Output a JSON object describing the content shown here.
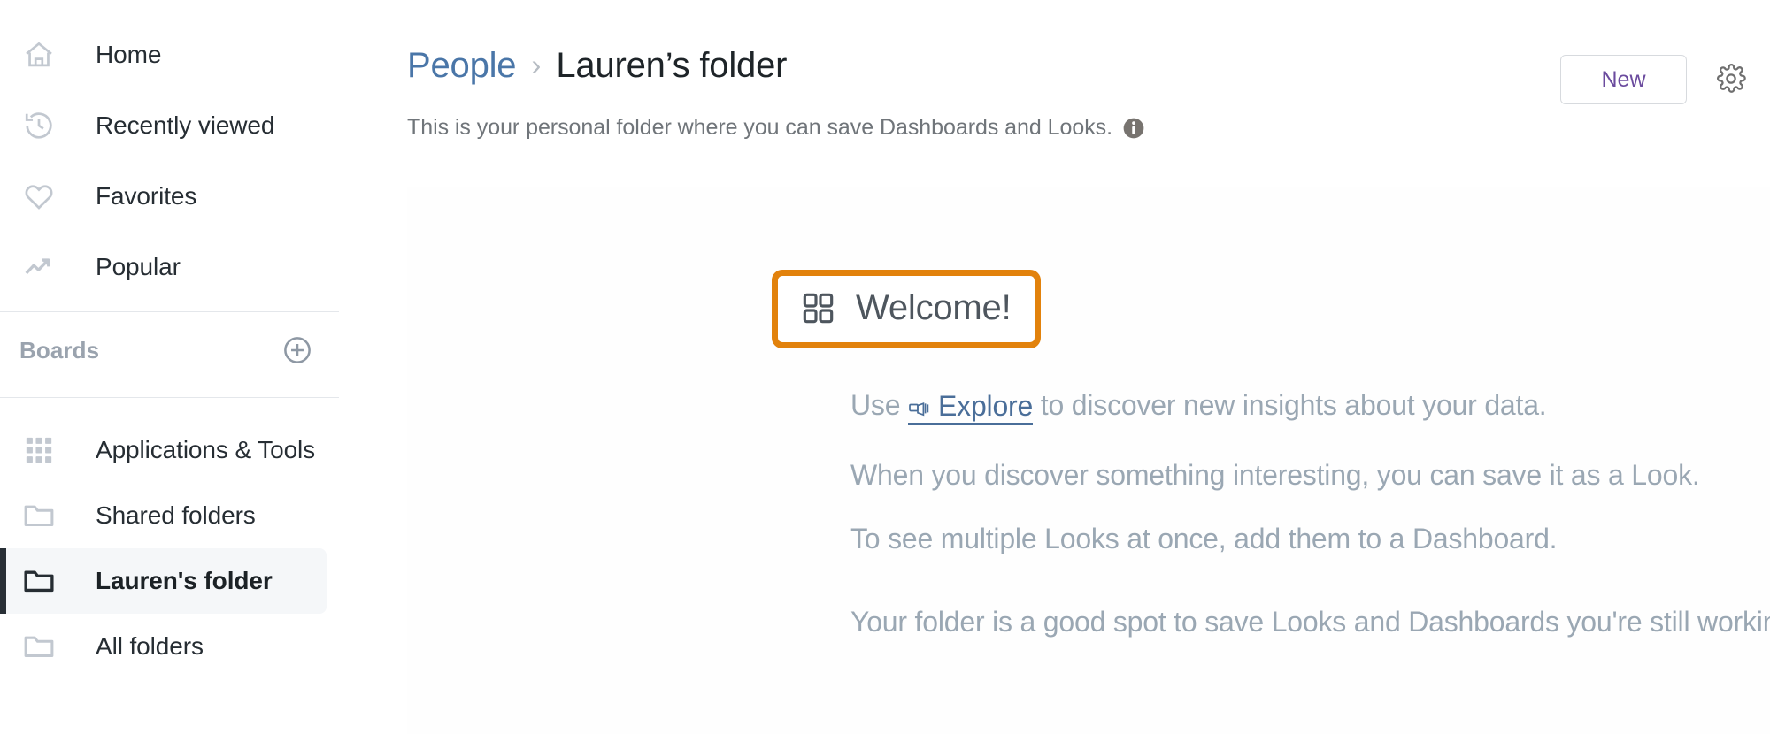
{
  "sidebar": {
    "nav_items": [
      {
        "label": "Home",
        "icon": "home-icon"
      },
      {
        "label": "Recently viewed",
        "icon": "history-clock-icon"
      },
      {
        "label": "Favorites",
        "icon": "heart-icon"
      },
      {
        "label": "Popular",
        "icon": "trending-up-icon"
      }
    ],
    "boards_section": {
      "title": "Boards",
      "add_icon": "plus-circle-icon"
    },
    "folder_items": [
      {
        "label": "Applications & Tools",
        "icon": "grid-apps-icon",
        "selected": false
      },
      {
        "label": "Shared folders",
        "icon": "folder-icon",
        "selected": false
      },
      {
        "label": "Lauren's folder",
        "icon": "folder-icon",
        "selected": true
      },
      {
        "label": "All folders",
        "icon": "folder-icon",
        "selected": false
      }
    ]
  },
  "header": {
    "breadcrumb_parent": "People",
    "breadcrumb_separator": "›",
    "breadcrumb_current": "Lauren’s folder",
    "subtitle": "This is your personal folder where you can save Dashboards and Looks.",
    "info_icon": "info-icon",
    "new_label": "New",
    "settings_icon": "gear-icon"
  },
  "welcome": {
    "icon": "dashboard-grid-icon",
    "title": "Welcome!",
    "highlight_color": "#e2820c"
  },
  "body": {
    "line1_prefix": "Use ",
    "line1_link": "Explore",
    "line1_link_icon": "explore-telescope-icon",
    "line1_suffix": " to discover new insights about your data.",
    "line2": "When you discover something interesting, you can save it as a Look.",
    "line3": "To see multiple Looks at once, add them to a Dashboard.",
    "line4": "Your folder is a good spot to save Looks and Dashboards you're still working on."
  },
  "colors": {
    "accent_orange": "#e2820c",
    "link_blue": "#4a76a8",
    "new_purple": "#6b4b9e",
    "muted_text": "#9aa7b3",
    "selected_bg": "#f5f7f9"
  }
}
